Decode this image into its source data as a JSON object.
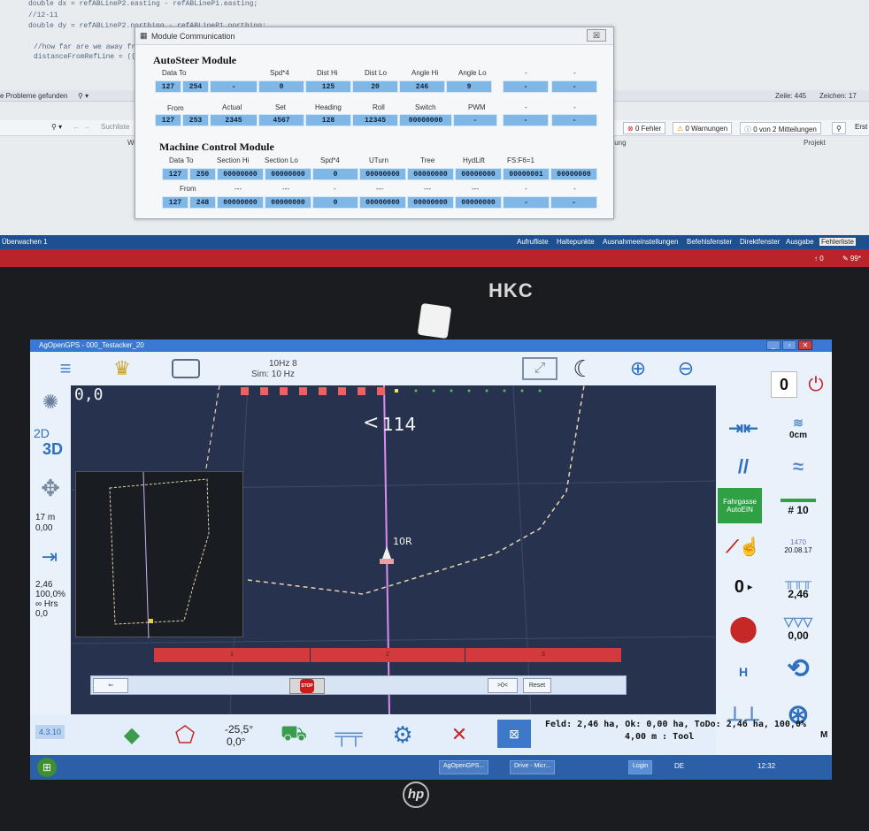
{
  "editor": {
    "code_lines": [
      "double dx = refABLineP2.easting - refABLineP1.easting;",
      "//12-11",
      "double dy = refABLineP2.northing - refABLineP1.northing;",
      "//how far are we away fr",
      "distanceFromRefLine = ((d"
    ],
    "problems": "e Probleme gefunden",
    "line": "Zeile: 445",
    "char": "Zeichen: 17",
    "search_placeholder": "Suchliste",
    "errors": "0 Fehler",
    "warnings": "0 Warnungen",
    "messages": "0 von 2 Mitteilungen",
    "build": "Erst",
    "col_value": "Wert",
    "col_desc": "ibung",
    "col_project": "Projekt",
    "watch": "Überwachen 1",
    "bottom_tabs": [
      "Aufrufliste",
      "Haltepunkte",
      "Ausnahmeeinstellungen",
      "Befehlsfenster",
      "Direktfenster",
      "Ausgabe",
      "Fehlerliste"
    ],
    "status_right_1": "↑ 0",
    "status_right_2": "✎ 99*"
  },
  "module_window": {
    "title": "Module Communication",
    "close": "☒",
    "autosteer": {
      "title": "AutoSteer Module",
      "row1_labels": [
        "Data To",
        "Spd*4",
        "Dist Hi",
        "Dist Lo",
        "Angle Hi",
        "Angle Lo",
        "-",
        "-"
      ],
      "row1_values": [
        "127",
        "254",
        "-",
        "0",
        "125",
        "20",
        "246",
        "9",
        "-",
        "-"
      ],
      "row2_labels": [
        "From",
        "Actual",
        "Set",
        "Heading",
        "Roll",
        "Switch",
        "PWM",
        "-",
        "-"
      ],
      "row2_values": [
        "127",
        "253",
        "2345",
        "4567",
        "128",
        "12345",
        "00000000",
        "-",
        "-",
        "-"
      ]
    },
    "machine": {
      "title": "Machine Control Module",
      "row1_labels": [
        "Data To",
        "Section Hi",
        "Section Lo",
        "Spd*4",
        "UTurn",
        "Tree",
        "HydLift",
        "FS:F6=1"
      ],
      "row1_values": [
        "127",
        "250",
        "00000000",
        "00000000",
        "0",
        "00000000",
        "00000000",
        "00000000",
        "00000001",
        "00000000"
      ],
      "row2_labels": [
        "From",
        "---",
        "---",
        "-",
        "---",
        "---",
        "---",
        "-",
        "-"
      ],
      "row2_values": [
        "127",
        "248",
        "00000000",
        "00000000",
        "0",
        "00000000",
        "00000000",
        "00000000",
        "-",
        "-"
      ]
    }
  },
  "laptop": {
    "bezel_brand": "HKC",
    "logo": "hp"
  },
  "aog": {
    "title": "AgOpenGPS - 000_Testacker_20",
    "hz": "10Hz 8",
    "sim": "Sim: 10 Hz",
    "heading_counter": "0",
    "coords": "0,0",
    "view_2d": "2D",
    "view_3d": "3D",
    "speed_line1": "17 m",
    "speed_line2": "0,00",
    "stats": [
      "2,46",
      "100,0%",
      "∞ Hrs",
      "0,0"
    ],
    "guidance_value": "114",
    "tool_label": "10R",
    "offset": "0cm",
    "tramline_label": "Fahrgasse AutoEIN",
    "abline_num": "# 10",
    "date": "20.08.17",
    "date_top": "1470",
    "snap_value": "0",
    "area_worked": "2,46",
    "area_applied": "0,00",
    "sections": [
      "1",
      "2",
      "3"
    ],
    "stop": "STOP",
    "btn_small": ">0<",
    "btn_reset": "Reset",
    "version": "4.3.10",
    "steer_angle": "-25,5°",
    "steer_angle2": "0,0°",
    "field_info": "Feld: 2,46 ha, Ok: 0,00 ha, ToDo: 2,46 ha, 100,0%",
    "tool_info": "4,00 m : Tool",
    "m_label": "M",
    "h_label": "H"
  },
  "taskbar": {
    "items": [
      "AgOpenGPS...",
      "Drive - Micr...",
      "Login"
    ],
    "lang": "DE",
    "time": "12:32"
  },
  "colors": {
    "field": "#27334e",
    "accent_blue": "#2b5fa8",
    "section_red": "#d23a3e",
    "cell_blue": "#7fb8e6",
    "tram_green": "#2fa043"
  }
}
